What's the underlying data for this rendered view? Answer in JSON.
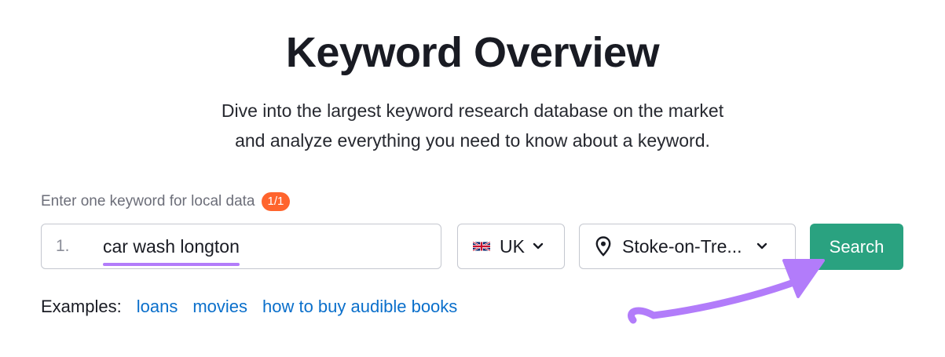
{
  "header": {
    "title": "Keyword Overview",
    "subtitle_line1": "Dive into the largest keyword research database on the market",
    "subtitle_line2": "and analyze everything you need to know about a keyword."
  },
  "form": {
    "hint": "Enter one keyword for local data",
    "counter_badge": "1/1",
    "row_number": "1.",
    "keyword_value": "car wash longton",
    "database": {
      "flag_icon": "uk-flag-icon",
      "label": "UK"
    },
    "location": {
      "icon": "map-pin-icon",
      "label": "Stoke-on-Tre..."
    },
    "search_label": "Search"
  },
  "examples": {
    "label": "Examples:",
    "links": [
      "loans",
      "movies",
      "how to buy audible books"
    ]
  },
  "colors": {
    "search_button": "#2aa280",
    "badge": "#ff642d",
    "link": "#0a6fcb",
    "annotation": "#b27cfa"
  }
}
